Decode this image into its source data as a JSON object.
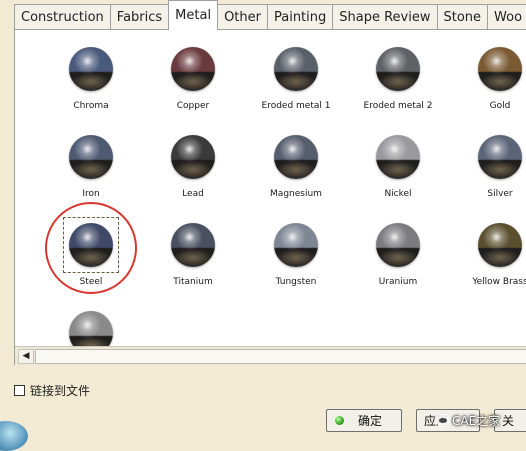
{
  "tabs": [
    "Construction",
    "Fabrics",
    "Metal",
    "Other",
    "Painting",
    "Shape Review",
    "Stone",
    "Woo"
  ],
  "active_tab": "Metal",
  "materials": [
    {
      "label": "Chroma",
      "icon": "chroma-sphere-icon",
      "color": "#4a5a7c"
    },
    {
      "label": "Copper",
      "icon": "copper-sphere-icon",
      "color": "#6a3a3e"
    },
    {
      "label": "Eroded metal 1",
      "icon": "eroded-metal-1-sphere-icon",
      "color": "#5a6068"
    },
    {
      "label": "Eroded metal 2",
      "icon": "eroded-metal-2-sphere-icon",
      "color": "#5e6266"
    },
    {
      "label": "Gold",
      "icon": "gold-sphere-icon",
      "color": "#7a5a32"
    },
    {
      "label": "Iron",
      "icon": "iron-sphere-icon",
      "color": "#4e5a72"
    },
    {
      "label": "Lead",
      "icon": "lead-sphere-icon",
      "color": "#3a3a3a"
    },
    {
      "label": "Magnesium",
      "icon": "magnesium-sphere-icon",
      "color": "#565e6e"
    },
    {
      "label": "Nickel",
      "icon": "nickel-sphere-icon",
      "color": "#9a9a9e"
    },
    {
      "label": "Silver",
      "icon": "silver-sphere-icon",
      "color": "#5c6478"
    },
    {
      "label": "Steel",
      "icon": "steel-sphere-icon",
      "color": "#3e4a68"
    },
    {
      "label": "Titanium",
      "icon": "titanium-sphere-icon",
      "color": "#4a5060"
    },
    {
      "label": "Tungsten",
      "icon": "tungsten-sphere-icon",
      "color": "#7e8694"
    },
    {
      "label": "Uranium",
      "icon": "uranium-sphere-icon",
      "color": "#7c7c7e"
    },
    {
      "label": "Yellow Brass",
      "icon": "yellow-brass-sphere-icon",
      "color": "#5a5030"
    },
    {
      "label": "",
      "icon": "gray-sphere-icon",
      "color": "#8a8a8a"
    }
  ],
  "selected_material": "Steel",
  "link_to_file_label": "链接到文件",
  "link_to_file_checked": false,
  "buttons": {
    "ok": "确定",
    "apply": "应用",
    "close": "关"
  },
  "watermark": "CAE之家",
  "colors": {
    "highlight": "#d8372f",
    "ok_indicator": "#2a9a17"
  }
}
